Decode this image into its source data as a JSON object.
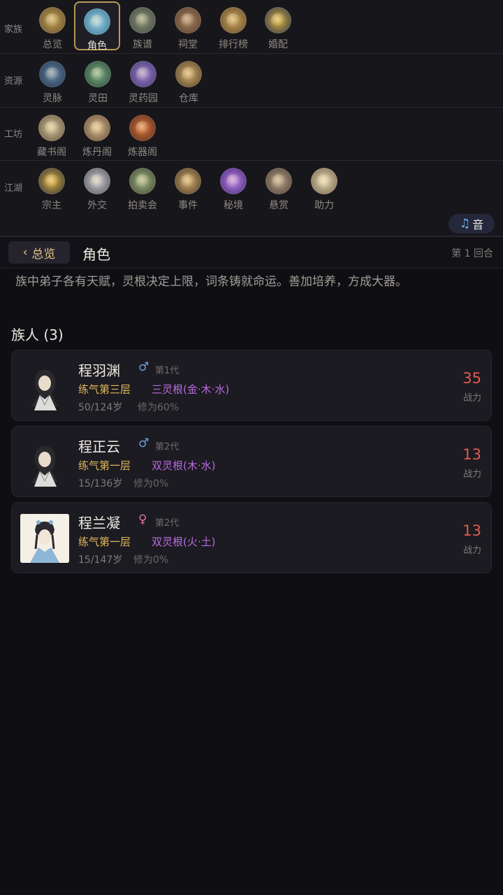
{
  "nav": {
    "rows": [
      {
        "label": "家族",
        "items": [
          {
            "label": "总览",
            "icon": "overview-icon",
            "color": "#8a7240"
          },
          {
            "label": "角色",
            "icon": "character-icon",
            "color": "#3f8fb0",
            "active": true
          },
          {
            "label": "族谱",
            "icon": "genealogy-icon",
            "color": "#5e6a58"
          },
          {
            "label": "祠堂",
            "icon": "ancestral-hall-icon",
            "color": "#6d5440"
          },
          {
            "label": "排行榜",
            "icon": "ranking-icon",
            "color": "#8a6b3a"
          },
          {
            "label": "婚配",
            "icon": "marriage-icon",
            "color": "#a37b2b"
          }
        ]
      },
      {
        "label": "资源",
        "items": [
          {
            "label": "灵脉",
            "icon": "spirit-vein-icon",
            "color": "#3b5a7a"
          },
          {
            "label": "灵田",
            "icon": "spirit-field-icon",
            "color": "#3f6e52"
          },
          {
            "label": "灵药园",
            "icon": "herb-garden-icon",
            "color": "#6a4fa0"
          },
          {
            "label": "仓库",
            "icon": "warehouse-icon",
            "color": "#8a6a3a"
          }
        ]
      },
      {
        "label": "工坊",
        "items": [
          {
            "label": "藏书阁",
            "icon": "library-icon",
            "color": "#8a7a5a"
          },
          {
            "label": "炼丹阁",
            "icon": "alchemy-icon",
            "color": "#8a6a4a"
          },
          {
            "label": "炼器阁",
            "icon": "forge-icon",
            "color": "#a0482e"
          }
        ]
      },
      {
        "label": "江湖",
        "items": [
          {
            "label": "宗主",
            "icon": "sect-master-icon",
            "color": "#b08a2a"
          },
          {
            "label": "外交",
            "icon": "diplomacy-icon",
            "color": "#7a7a80"
          },
          {
            "label": "拍卖会",
            "icon": "auction-icon",
            "color": "#5a6e4a"
          },
          {
            "label": "事件",
            "icon": "event-icon",
            "color": "#8a6a3a"
          },
          {
            "label": "秘境",
            "icon": "secret-realm-icon",
            "color": "#7a3fb0"
          },
          {
            "label": "悬赏",
            "icon": "bounty-icon",
            "color": "#7a6a5a"
          },
          {
            "label": "助力",
            "icon": "assist-icon",
            "color": "#9a8a6a"
          }
        ]
      }
    ],
    "music_label": "音"
  },
  "header": {
    "back_label": "总览",
    "title": "角色",
    "turn": "第 1 回合"
  },
  "description": "族中弟子各有天赋，灵根决定上限，词条铸就命运。善加培养，方成大器。",
  "section_title": "族人 (3)",
  "members": [
    {
      "name": "程羽渊",
      "gender": "♂",
      "generation": "第1代",
      "realm": "练气第三层",
      "root": "三灵根(金·木·水)",
      "age": "50/124岁",
      "cultivation": "修为60%",
      "power": "35",
      "power_label": "战力"
    },
    {
      "name": "程正云",
      "gender": "♂",
      "generation": "第2代",
      "realm": "练气第一层",
      "root": "双灵根(木·水)",
      "age": "15/136岁",
      "cultivation": "修为0%",
      "power": "13",
      "power_label": "战力"
    },
    {
      "name": "程兰凝",
      "gender": "♀",
      "generation": "第2代",
      "realm": "练气第一层",
      "root": "双灵根(火·土)",
      "age": "15/147岁",
      "cultivation": "修为0%",
      "power": "13",
      "power_label": "战力"
    }
  ]
}
